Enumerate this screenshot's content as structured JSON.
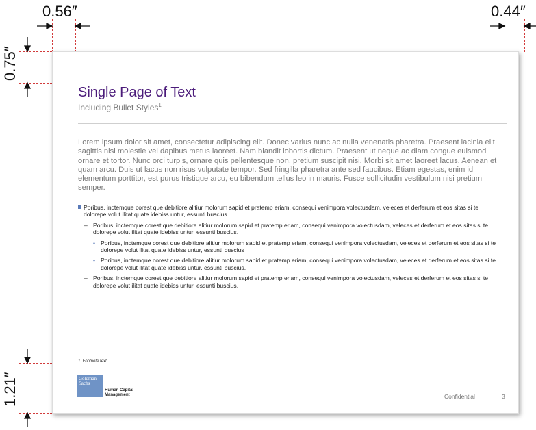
{
  "margins": {
    "left": "0.56″",
    "right": "0.44″",
    "top": "0.75″",
    "bottom": "1.21″"
  },
  "slide": {
    "title": "Single Page of Text",
    "subtitle": "Including Bullet Styles",
    "subtitle_sup": "1",
    "body_text": "Lorem ipsum dolor sit amet, consectetur adipiscing elit. Donec varius nunc ac nulla venenatis pharetra. Praesent lacinia elit sagittis nisi molestie vel dapibus metus laoreet. Nam blandit lobortis dictum. Praesent ut neque ac diam congue euismod ornare et tortor. Nunc orci turpis, ornare quis pellentesque non, pretium suscipit nisi. Morbi sit amet laoreet lacus. Aenean et quam arcu. Duis ut lacus non risus vulputate tempor. Sed fringilla pharetra ante sed faucibus. Etiam egestas, enim id elementum porttitor, est purus tristique arcu, eu bibendum tellus leo in mauris. Fusce sollicitudin vestibulum nisi pretium semper.",
    "bullets": [
      {
        "level": 1,
        "text": "Poribus, inctemque corest que debitiore alitiur molorum sapid et pratemp eriam, consequi venimpora volectusdam, veleces et derferum et eos sitas si te dolorepe volut ilitat quate idebiss untur, essunti buscius."
      },
      {
        "level": 2,
        "text": "Poribus, inctemque corest que debitiore alitiur molorum sapid et pratemp eriam, consequi venimpora volectusdam, veleces et derferum et eos sitas si te dolorepe volut ilitat quate idebiss untur, essunti buscius."
      },
      {
        "level": 3,
        "text": "Poribus, inctemque corest que debitiore alitiur molorum sapid et pratemp eriam, consequi venimpora volectusdam, veleces et derferum et eos sitas si te dolorepe volut ilitat quate idebiss untur, essunti buscius"
      },
      {
        "level": 3,
        "text": "Poribus, inctemque corest que debitiore alitiur molorum sapid et pratemp eriam, consequi venimpora volectusdam, veleces et derferum et eos sitas si te dolorepe volut ilitat quate idebiss untur, essunti buscius."
      },
      {
        "level": 2,
        "text": "Poribus, inctemque corest que debitiore alitiur molorum sapid et pratemp eriam, consequi venimpora volectusdam, veleces et derferum et eos sitas si te dolorepe volut ilitat quate idebiss untur, essunti buscius."
      }
    ],
    "footnote": "1.   Footnote text.",
    "logo_text": "Goldman Sachs",
    "division": "Human Capital Management",
    "confidential": "Confidential",
    "page_number": "3"
  },
  "colors": {
    "title": "#4b1b7a",
    "guide": "#d23b3b",
    "logo": "#6f93c6",
    "bullet": "#5a7ab8"
  }
}
